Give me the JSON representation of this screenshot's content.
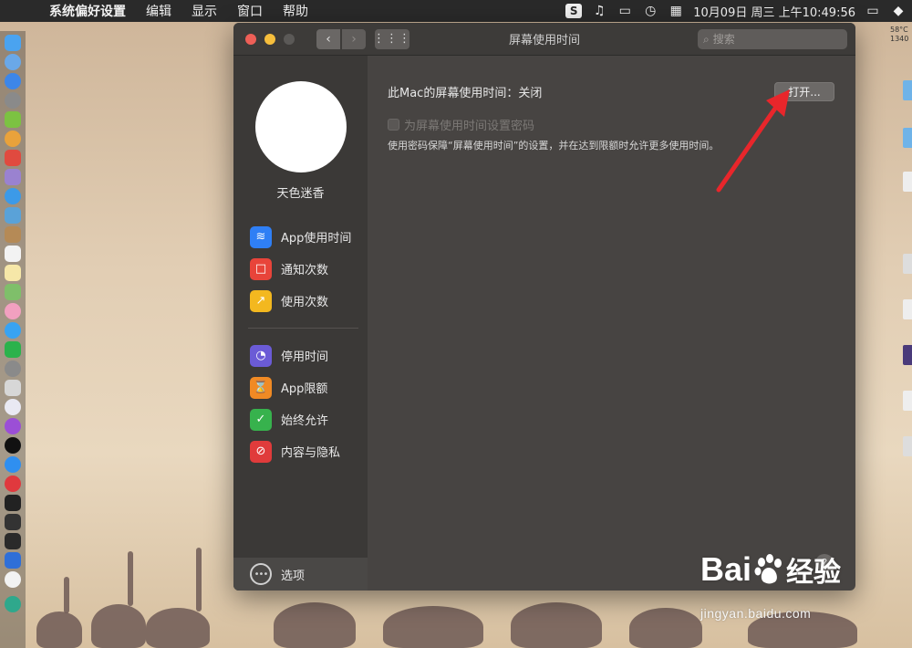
{
  "menubar": {
    "app_name": "系统偏好设置",
    "items": [
      "编辑",
      "显示",
      "窗口",
      "帮助"
    ],
    "clock": "10月09日 周三 上午10:49:56",
    "temp_top": "58°C",
    "temp_bottom": "1340"
  },
  "window": {
    "title": "屏幕使用时间",
    "search_placeholder": "搜索"
  },
  "sidebar": {
    "username": "天色迷香",
    "group1": [
      {
        "label": "App使用时间",
        "icon": "layers-icon",
        "color": "#2f7ff5"
      },
      {
        "label": "通知次数",
        "icon": "notification-icon",
        "color": "#e8443a"
      },
      {
        "label": "使用次数",
        "icon": "pickup-icon",
        "color": "#f3b81f"
      }
    ],
    "group2": [
      {
        "label": "停用时间",
        "icon": "downtime-icon",
        "color": "#6b5bd6"
      },
      {
        "label": "App限额",
        "icon": "hourglass-icon",
        "color": "#f08a24"
      },
      {
        "label": "始终允许",
        "icon": "checkmark-shield-icon",
        "color": "#37b24d"
      },
      {
        "label": "内容与隐私",
        "icon": "restriction-icon",
        "color": "#e03b3b"
      }
    ],
    "options_label": "选项"
  },
  "main": {
    "status_label": "此Mac的屏幕使用时间：",
    "status_value": "关闭",
    "open_button": "打开...",
    "password_checkbox_label": "为屏幕使用时间设置密码",
    "password_description": "使用密码保障“屏幕使用时间”的设置，并在达到限额时允许更多使用时间。",
    "help": "?"
  },
  "watermark": {
    "brand_left": "Bai",
    "brand_right": "经验",
    "url": "jingyan.baidu.com"
  }
}
